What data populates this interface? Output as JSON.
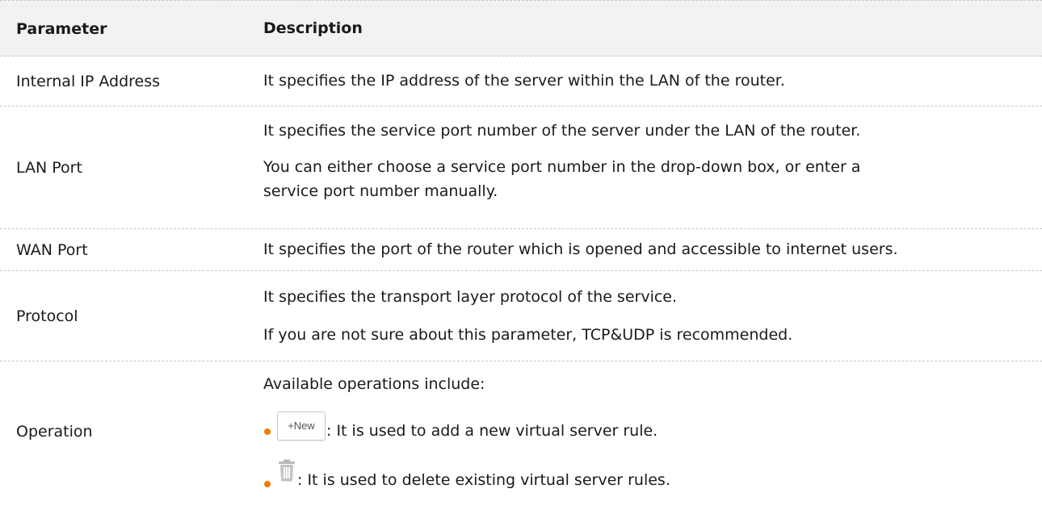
{
  "table": {
    "header": {
      "parameter": "Parameter",
      "description": "Description"
    },
    "rows": [
      {
        "parameter": "Internal IP Address",
        "description": [
          "It specifies the IP address of the server within the LAN of the router."
        ]
      },
      {
        "parameter": "LAN Port",
        "description": [
          "It specifies the service port number of the server under the LAN of the router.",
          "You can either choose a service port number in the drop-down box, or enter a",
          "service port number manually."
        ]
      },
      {
        "parameter": "WAN Port",
        "description": [
          "It specifies the port of the router which is opened and accessible to internet users."
        ]
      },
      {
        "parameter": "Protocol",
        "description": [
          "It specifies the transport layer protocol of the service.",
          "If you are not sure about this parameter, TCP&UDP is recommended."
        ]
      },
      {
        "parameter": "Operation",
        "intro": "Available operations include:",
        "items": [
          {
            "icon": "new-button",
            "button_label": "+New",
            "text": ": It is used to add a new virtual server rule."
          },
          {
            "icon": "trash-icon",
            "text": ": It is used to delete existing virtual server rules."
          }
        ]
      }
    ]
  },
  "colors": {
    "bullet": "#f07d00",
    "header_bg": "#f2f2f2",
    "divider": "#c8c8c8"
  }
}
